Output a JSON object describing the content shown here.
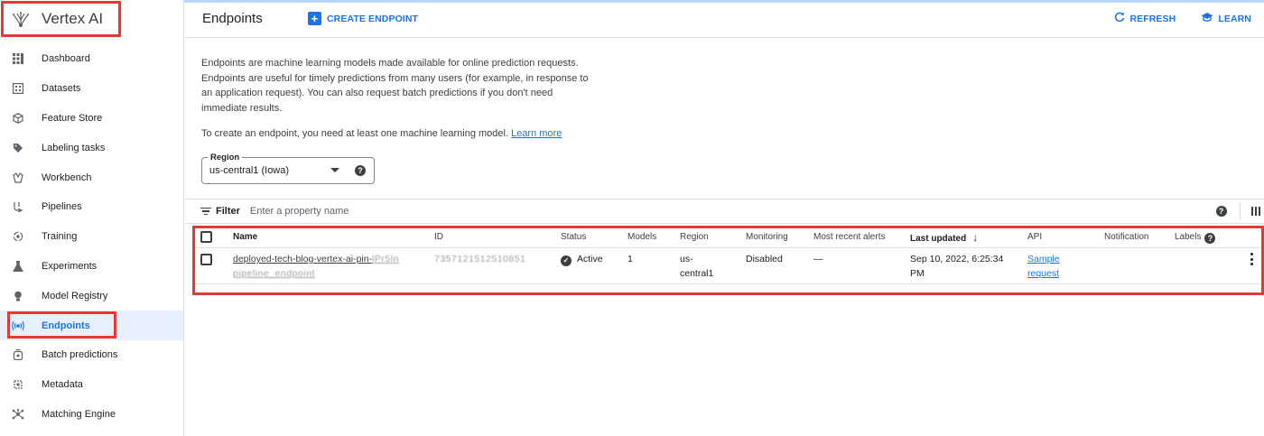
{
  "app": {
    "title": "Vertex AI"
  },
  "sidebar": {
    "items": [
      {
        "label": "Dashboard",
        "icon": "dashboard-icon"
      },
      {
        "label": "Datasets",
        "icon": "datasets-icon"
      },
      {
        "label": "Feature Store",
        "icon": "feature-store-icon"
      },
      {
        "label": "Labeling tasks",
        "icon": "label-tag-icon"
      },
      {
        "label": "Workbench",
        "icon": "workbench-icon"
      },
      {
        "label": "Pipelines",
        "icon": "pipelines-icon"
      },
      {
        "label": "Training",
        "icon": "training-icon"
      },
      {
        "label": "Experiments",
        "icon": "flask-icon"
      },
      {
        "label": "Model Registry",
        "icon": "lightbulb-icon"
      },
      {
        "label": "Endpoints",
        "icon": "endpoints-icon",
        "active": true
      },
      {
        "label": "Batch predictions",
        "icon": "batch-predictions-icon"
      },
      {
        "label": "Metadata",
        "icon": "metadata-icon"
      },
      {
        "label": "Matching Engine",
        "icon": "matching-engine-icon"
      }
    ]
  },
  "header": {
    "title": "Endpoints",
    "create_label": "CREATE ENDPOINT",
    "refresh_label": "REFRESH",
    "learn_label": "LEARN"
  },
  "intro": {
    "description": "Endpoints are machine learning models made available for online prediction requests. Endpoints are useful for timely predictions from many users (for example, in response to an application request). You can also request batch predictions if you don't need immediate results.",
    "requirement": "To create an endpoint, you need at least one machine learning model.",
    "learn_more": "Learn more"
  },
  "region": {
    "label": "Region",
    "value": "us-central1 (Iowa)"
  },
  "filter": {
    "label": "Filter",
    "placeholder": "Enter a property name"
  },
  "table": {
    "columns": {
      "name": "Name",
      "id": "ID",
      "status": "Status",
      "models": "Models",
      "region": "Region",
      "monitoring": "Monitoring",
      "alerts": "Most recent alerts",
      "updated": "Last updated",
      "api": "API",
      "notification": "Notification",
      "labels": "Labels"
    },
    "rows": [
      {
        "name_line1": "deployed-tech-blog-vertex-ai-pin-",
        "name_blur1": "lPr5ln",
        "name_line2": "pipeline_endpoint",
        "id": "7357121512510851",
        "status": "Active",
        "models": "1",
        "region_line1": "us-",
        "region_line2": "central1",
        "monitoring": "Disabled",
        "alerts": "—",
        "updated_line1": "Sep 10, 2022, 6:25:34",
        "updated_line2": "PM",
        "api_line1": "Sample",
        "api_line2": "request"
      }
    ]
  }
}
